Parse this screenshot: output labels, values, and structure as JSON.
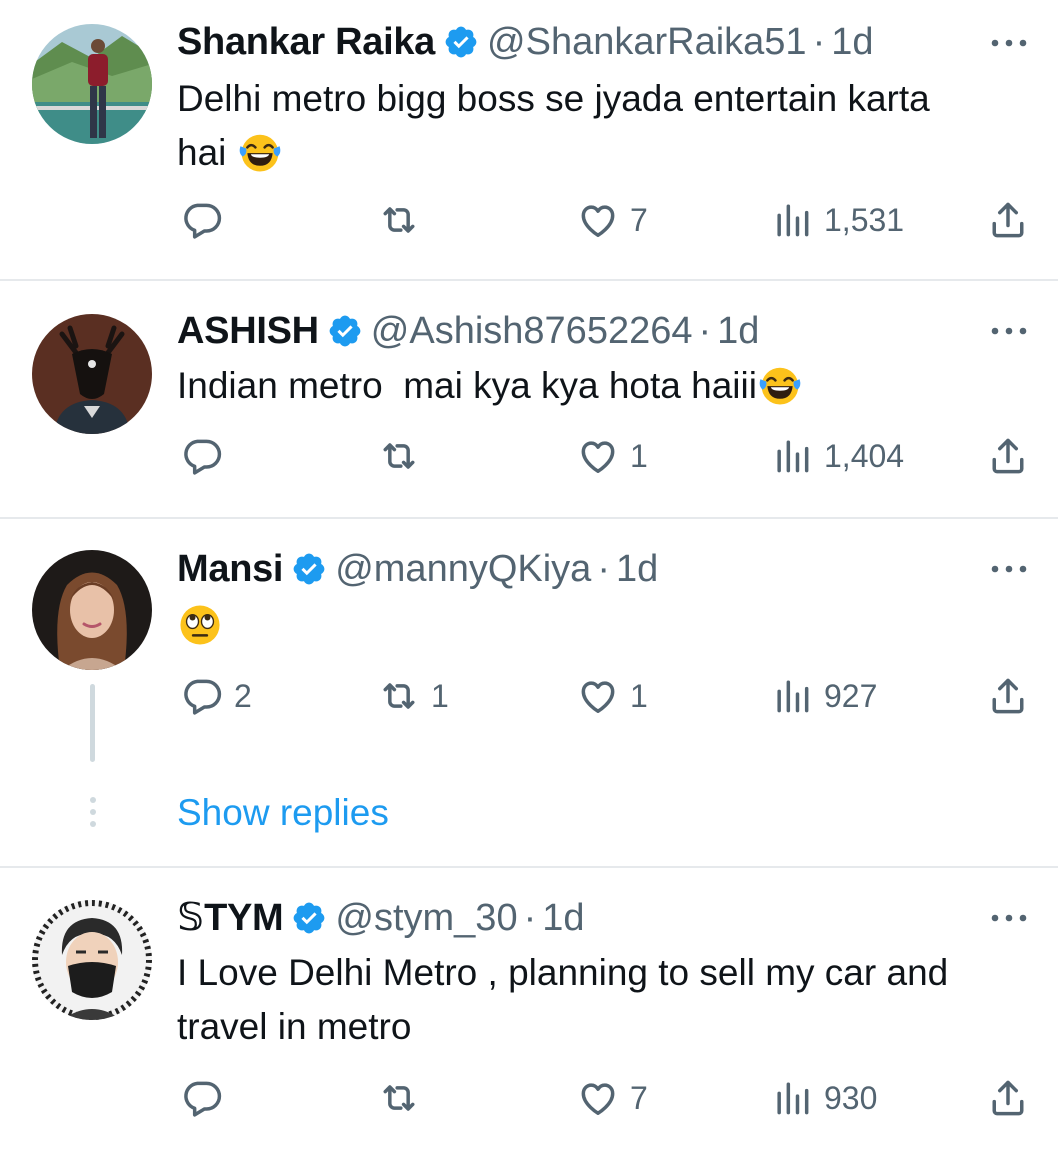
{
  "colors": {
    "verified": "#1d9bf0",
    "link": "#1d9bf0",
    "muted": "#536471",
    "text": "#0f1419",
    "divider": "#e6e9ec"
  },
  "icons": [
    "verified-badge-icon",
    "more-options-icon",
    "reply-icon",
    "retweet-icon",
    "like-icon",
    "views-icon",
    "share-icon",
    "laughing-emoji",
    "eye-roll-emoji"
  ],
  "tweets": [
    {
      "name": "Shankar Raika",
      "handle": "@ShankarRaika51",
      "dot": "·",
      "time": "1d",
      "text_line1": "Delhi metro bigg boss se jyada entertain karta",
      "text_line2": "hai",
      "emoji": "laughing-emoji",
      "replies": "",
      "retweets": "",
      "likes": "7",
      "views": "1,531"
    },
    {
      "name": "ASHISH",
      "handle": "@Ashish87652264",
      "dot": "·",
      "time": "1d",
      "text_line1": "Indian metro  mai kya kya hota haiii",
      "emoji": "laughing-emoji",
      "replies": "",
      "retweets": "",
      "likes": "1",
      "views": "1,404"
    },
    {
      "name": "Mansi",
      "handle": "@mannyQKiya",
      "dot": "·",
      "time": "1d",
      "text_line1": "",
      "emoji": "eye-roll-emoji",
      "replies": "2",
      "retweets": "1",
      "likes": "1",
      "views": "927",
      "show_replies": "Show replies"
    },
    {
      "name": "𝕊TYM",
      "handle": "@stym_30",
      "dot": "·",
      "time": "1d",
      "text_line1": "I Love Delhi Metro , planning to sell my car and",
      "text_line2": "travel in metro",
      "replies": "",
      "retweets": "",
      "likes": "7",
      "views": "930"
    }
  ]
}
